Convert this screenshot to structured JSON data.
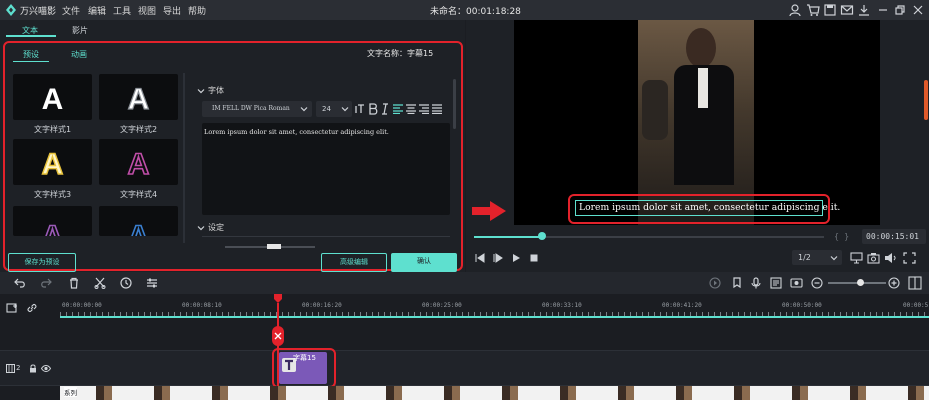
{
  "titlebar": {
    "app_name": "万兴喵影",
    "menus": [
      "文件",
      "编辑",
      "工具",
      "视图",
      "导出",
      "帮助"
    ],
    "document_title": "未命名：00:01:18:28"
  },
  "left_panel": {
    "tabs": [
      "文本",
      "影片"
    ],
    "subtabs": [
      "预设",
      "动画"
    ],
    "text_name_label": "文字名称：字幕15",
    "styles": [
      "文字样式1",
      "文字样式2",
      "文字样式3",
      "文字样式4"
    ],
    "font_section": "字体",
    "font_name": "IM FELL DW Pica Roman",
    "font_size": "24",
    "text_content": "Lorem ipsum dolor sit amet, consectetur adipiscing elit.",
    "settings_section": "设定",
    "save_preset_label": "保存为预设",
    "advanced_edit_label": "高级编辑",
    "confirm_label": "确认"
  },
  "preview": {
    "caption": "Lorem ipsum dolor sit amet, consectetur adipiscing elit.",
    "timecode": "00:00:15:01",
    "zoom": "1/2"
  },
  "timeline": {
    "ruler": [
      "00:00:00:00",
      "00:00:08:10",
      "00:00:16:20",
      "00:00:25:00",
      "00:00:33:10",
      "00:00:41:20",
      "00:00:50:00",
      "00:00:5"
    ],
    "track_number": "2",
    "text_clip_label": "字幕15",
    "video_clip_label": "系列"
  },
  "colors": {
    "accent": "#5ee0cf",
    "highlight": "#e3222b",
    "clip_purple": "#7b59b8"
  }
}
